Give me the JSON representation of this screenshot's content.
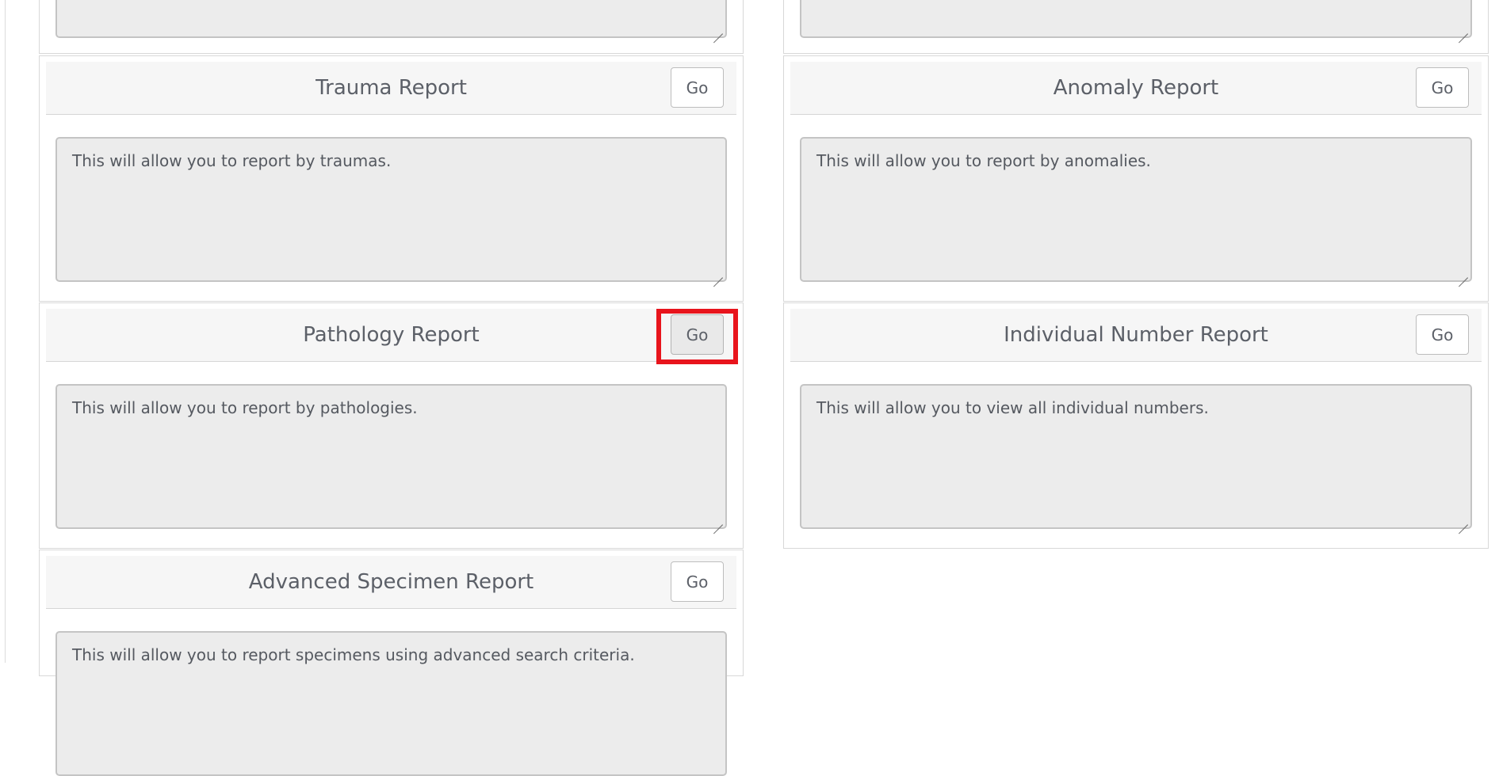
{
  "cards": [
    {
      "title": "Trauma Report",
      "button": "Go",
      "description": "This will allow you to report by traumas."
    },
    {
      "title": "Anomaly Report",
      "button": "Go",
      "description": "This will allow you to report by anomalies."
    },
    {
      "title": "Pathology Report",
      "button": "Go",
      "description": "This will allow you to report by pathologies."
    },
    {
      "title": "Individual Number Report",
      "button": "Go",
      "description": "This will allow you to view all individual numbers."
    },
    {
      "title": "Advanced Specimen Report",
      "button": "Go",
      "description": "This will allow you to report specimens using advanced search criteria."
    }
  ],
  "highlight_color": "#e8141c"
}
